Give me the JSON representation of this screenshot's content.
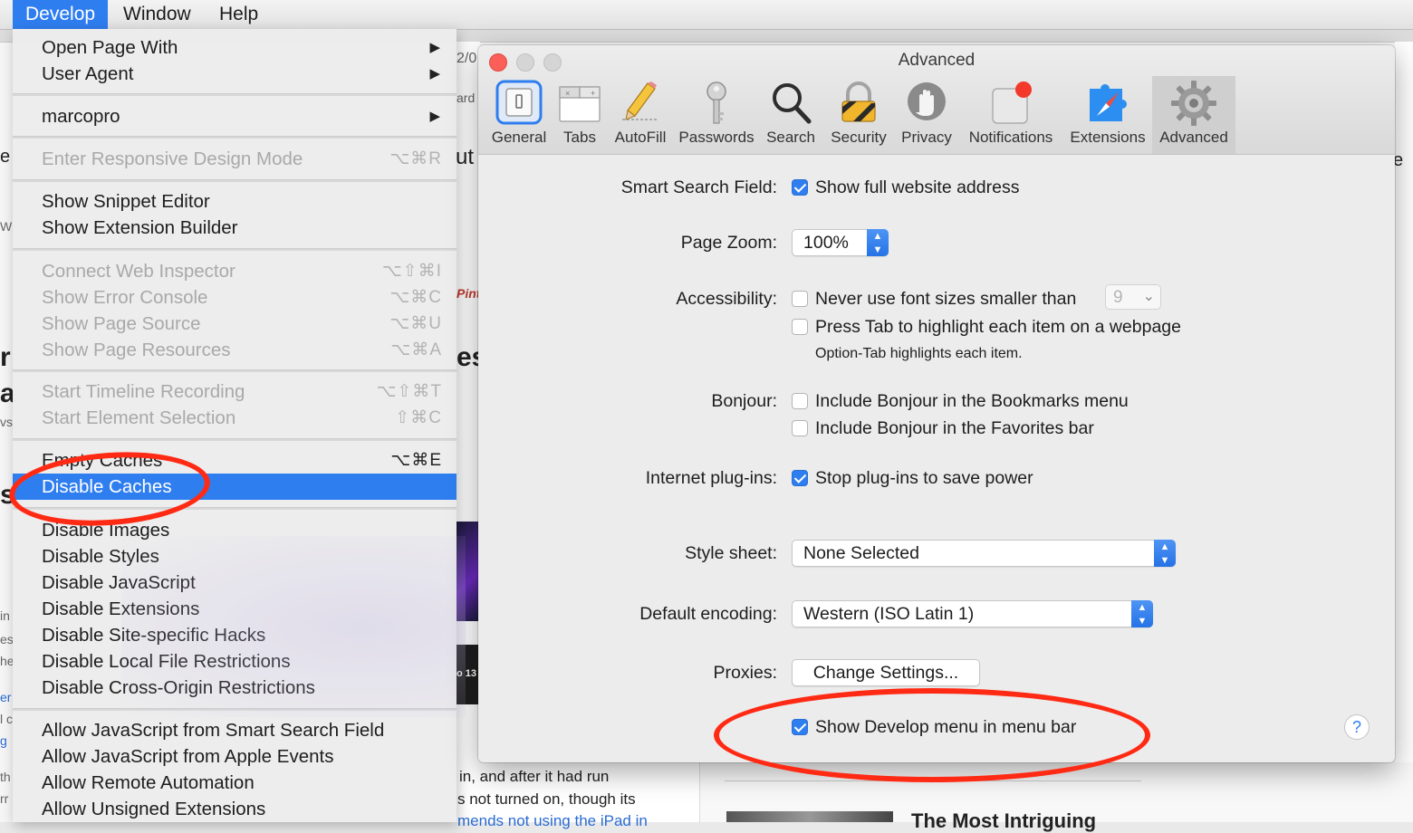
{
  "menubar": {
    "items": [
      {
        "label": "Develop",
        "active": true
      },
      {
        "label": "Window",
        "active": false
      },
      {
        "label": "Help",
        "active": false
      }
    ]
  },
  "develop_menu": {
    "items": [
      {
        "label": "Open Page With",
        "submenu": true
      },
      {
        "label": "User Agent",
        "submenu": true
      },
      {
        "label": "marcopro",
        "submenu": true
      },
      {
        "label": "Enter Responsive Design Mode",
        "shortcut": "⌥⌘R",
        "disabled": true
      },
      {
        "label": "Show Snippet Editor"
      },
      {
        "label": "Show Extension Builder"
      },
      {
        "label": "Connect Web Inspector",
        "shortcut": "⌥⇧⌘I",
        "disabled": true
      },
      {
        "label": "Show Error Console",
        "shortcut": "⌥⌘C",
        "disabled": true
      },
      {
        "label": "Show Page Source",
        "shortcut": "⌥⌘U",
        "disabled": true
      },
      {
        "label": "Show Page Resources",
        "shortcut": "⌥⌘A",
        "disabled": true
      },
      {
        "label": "Start Timeline Recording",
        "shortcut": "⌥⇧⌘T",
        "disabled": true
      },
      {
        "label": "Start Element Selection",
        "shortcut": "⇧⌘C",
        "disabled": true
      },
      {
        "label": "Empty Caches",
        "shortcut": "⌥⌘E"
      },
      {
        "label": "Disable Caches",
        "highlighted": true
      },
      {
        "label": "Disable Images"
      },
      {
        "label": "Disable Styles"
      },
      {
        "label": "Disable JavaScript"
      },
      {
        "label": "Disable Extensions"
      },
      {
        "label": "Disable Site-specific Hacks"
      },
      {
        "label": "Disable Local File Restrictions"
      },
      {
        "label": "Disable Cross-Origin Restrictions"
      },
      {
        "label": "Allow JavaScript from Smart Search Field"
      },
      {
        "label": "Allow JavaScript from Apple Events"
      },
      {
        "label": "Allow Remote Automation"
      },
      {
        "label": "Allow Unsigned Extensions"
      }
    ]
  },
  "prefs": {
    "title": "Advanced",
    "tabs": [
      {
        "label": "General",
        "icon": "general-switch-icon"
      },
      {
        "label": "Tabs",
        "icon": "tabs-icon"
      },
      {
        "label": "AutoFill",
        "icon": "pencil-icon"
      },
      {
        "label": "Passwords",
        "icon": "key-icon"
      },
      {
        "label": "Search",
        "icon": "magnifier-icon"
      },
      {
        "label": "Security",
        "icon": "padlock-icon"
      },
      {
        "label": "Privacy",
        "icon": "hand-icon"
      },
      {
        "label": "Notifications",
        "icon": "notification-badge-icon"
      },
      {
        "label": "Extensions",
        "icon": "puzzle-compass-icon"
      },
      {
        "label": "Advanced",
        "icon": "gear-icon",
        "selected": true
      }
    ],
    "smart_search": {
      "label": "Smart Search Field:",
      "option": "Show full website address",
      "checked": true
    },
    "page_zoom": {
      "label": "Page Zoom:",
      "value": "100%"
    },
    "accessibility": {
      "label": "Accessibility:",
      "font_option": "Never use font sizes smaller than",
      "font_checked": false,
      "font_size": "9",
      "tab_option": "Press Tab to highlight each item on a webpage",
      "tab_checked": false,
      "tab_hint": "Option-Tab highlights each item."
    },
    "bonjour": {
      "label": "Bonjour:",
      "bookmarks_option": "Include Bonjour in the Bookmarks menu",
      "bookmarks_checked": false,
      "favorites_option": "Include Bonjour in the Favorites bar",
      "favorites_checked": false
    },
    "plugins": {
      "label": "Internet plug-ins:",
      "option": "Stop plug-ins to save power",
      "checked": true
    },
    "stylesheet": {
      "label": "Style sheet:",
      "value": "None Selected"
    },
    "encoding": {
      "label": "Default encoding:",
      "value": "Western (ISO Latin 1)"
    },
    "proxies": {
      "label": "Proxies:",
      "button": "Change Settings..."
    },
    "develop_menu_option": {
      "option": "Show Develop menu in menu bar",
      "checked": true
    },
    "help_label": "?"
  },
  "background": {
    "frag_e": "e",
    "frag_ut": "ut",
    "frag_2o": "2/0",
    "frag_ard": "ard",
    "frag_es": "es",
    "frag_pint": "Pint",
    "frag_r": "r",
    "frag_a": "a",
    "frag_s": "s",
    "frag_e2": "e",
    "frag_w": "W",
    "frag_vs": "vs",
    "frag_left_lines": [
      "in",
      "es",
      "he",
      "er",
      "l c",
      "g",
      "th",
      "rr"
    ],
    "frag_o13": "o 13",
    "frag_article_lines": [
      "in, and after it had run",
      "s not turned on, though its",
      "mends not using the iPad in"
    ],
    "frag_headline": "The Most Intriguing"
  },
  "colors": {
    "accent": "#2f7ef0",
    "annotation": "#ff2a14",
    "close": "#fc5f57"
  }
}
